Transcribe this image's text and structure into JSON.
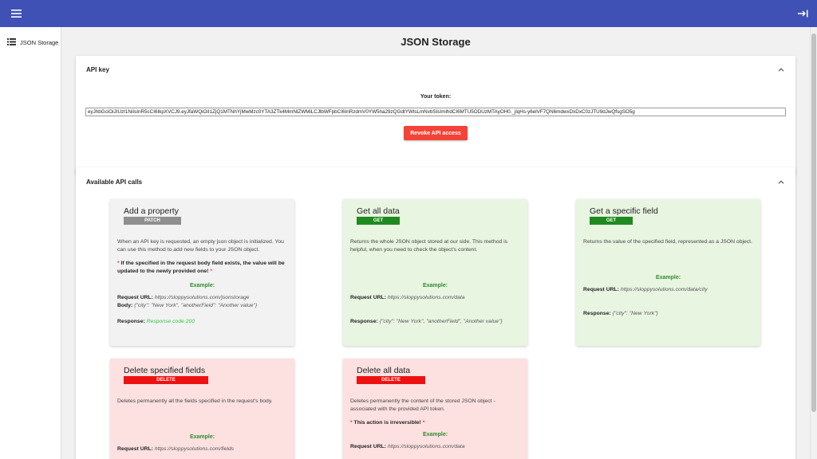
{
  "header": {
    "menu_icon": "menu-icon",
    "exit_icon": "arrow-to-right-icon",
    "accent": "#3f51b5"
  },
  "sidebar": {
    "items": [
      {
        "label": "JSON Storage",
        "icon": "list-icon"
      }
    ]
  },
  "page": {
    "title": "JSON Storage"
  },
  "api_key": {
    "title": "API key",
    "token_label": "Your token:",
    "token": "eyJhbGciOiJIUzI1NiIsInR5cCI6IkpXVCJ9.eyJfaWQiOiI1ZjQ1MTNhYjMwMzc0YTA3ZTk4MmNlZWMiLCJlbWFpbCI6InRzdmV0YW5ha29zQGdtYWlsLmNvbSIsImlhdCI6MTU5ODUzMTAyOH0._jlqHs-y6elVF7QN6mdwxDxDxC0zJTU9dJwQfsgSO5g",
    "revoke_label": "Revoke API access"
  },
  "calls": {
    "title": "Available API calls",
    "example_label": "Example:",
    "request_url_label": "Request URL:",
    "body_label": "Body:",
    "response_label": "Response:",
    "cards": [
      {
        "title": "Add a property",
        "method": "PATCH",
        "description": "When an API key is requested, an empty json object is initialized. You can use this method to add new fields to your JSON object.",
        "warning": "If the specified in the request body field exists, the value will be updated to the newly provided one!",
        "request_url": "https://sloppysolutions.com/jsonstorage",
        "body": "{\"city\": \"New York\", \"anotherField\": \"Another value\"}",
        "response": "Response code 200"
      },
      {
        "title": "Get all data",
        "method": "GET",
        "description": "Returns the whole JSON object stored at our side. This method is helpful, when you need to check the object's content.",
        "request_url": "https://sloppysolutions.com/data",
        "response": "{\"city\": \"New York\", \"anotherField\", \"Another value\"}"
      },
      {
        "title": "Get a specific field",
        "method": "GET",
        "description": "Returns the value of the specified field, represented as a JSON object.",
        "request_url": "https://sloppysolutions.com/data/city",
        "response": "{\"city\": \"New York\"}"
      },
      {
        "title": "Delete specified fields",
        "method": "DELETE",
        "description": "Deletes permanently all the fields specified in the request's body.",
        "request_url": "https://sloppysolutions.com/fields"
      },
      {
        "title": "Delete all data",
        "method": "DELETE",
        "description": "Deletes permanently the content of the stored JSON object - associated with the provided API token.",
        "warning": "This action is irreversible!",
        "request_url": "https://sloppysolutions.com/data"
      }
    ]
  }
}
